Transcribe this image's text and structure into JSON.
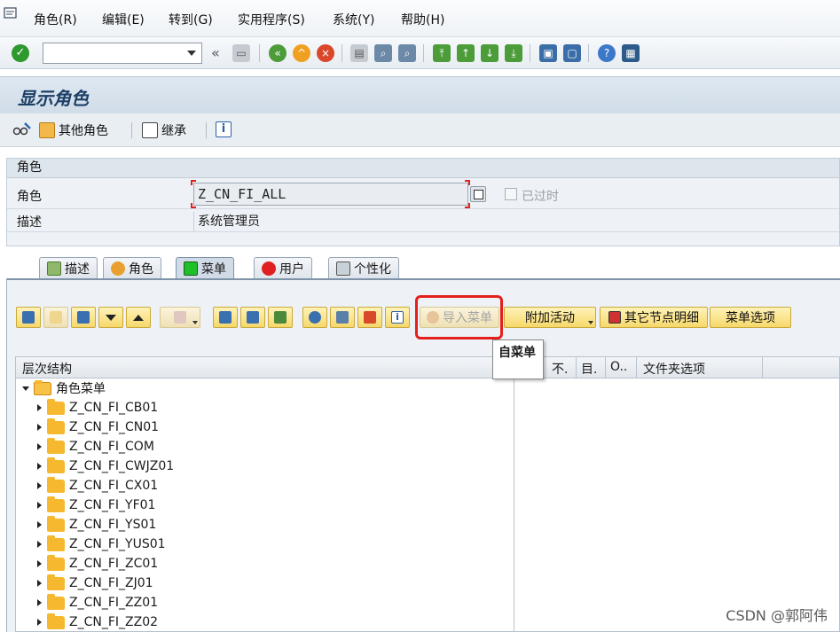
{
  "menubar": {
    "items": [
      "角色(R)",
      "编辑(E)",
      "转到(G)",
      "实用程序(S)",
      "系统(Y)",
      "帮助(H)"
    ]
  },
  "stdbar": {
    "command_value": "",
    "icons": [
      "enter-icon",
      "save-icon",
      "back-icon",
      "exit-icon",
      "cancel-icon",
      "print-icon",
      "find-icon",
      "find-next-icon",
      "first-page-icon",
      "prev-page-icon",
      "next-page-icon",
      "last-page-icon",
      "new-session-icon",
      "shortcut-icon",
      "help-icon",
      "layout-menu-icon"
    ]
  },
  "title": "显示角色",
  "apptoolbar": {
    "other_roles": "其他角色",
    "inherit": "继承"
  },
  "role_group": {
    "title": "角色",
    "role_label": "角色",
    "role_value": "Z_CN_FI_ALL",
    "obsolete_label": "已过时",
    "desc_label": "描述",
    "desc_value": "系统管理员"
  },
  "tabs": [
    {
      "label": "描述",
      "icon": "description-icon"
    },
    {
      "label": "角色",
      "icon": "role-icon"
    },
    {
      "label": "菜单",
      "icon": "menu-icon",
      "active": true
    },
    {
      "label": "用户",
      "icon": "user-icon"
    },
    {
      "label": "个性化",
      "icon": "personalization-icon"
    }
  ],
  "menu_toolbar": {
    "import_menu": "导入菜单",
    "additional_activities": "附加活动",
    "other_node_details": "其它节点明细",
    "menu_options": "菜单选项",
    "tooltip": "自菜单"
  },
  "tree": {
    "headers": {
      "hierarchy": "层次结构",
      "col_n": "不.",
      "col_m": "目.",
      "col_o": "O..",
      "col_folder": "文件夹选项"
    },
    "root": "角色菜单",
    "nodes": [
      "Z_CN_FI_CB01",
      "Z_CN_FI_CN01",
      "Z_CN_FI_COM",
      "Z_CN_FI_CWJZ01",
      "Z_CN_FI_CX01",
      "Z_CN_FI_YF01",
      "Z_CN_FI_YS01",
      "Z_CN_FI_YUS01",
      "Z_CN_FI_ZC01",
      "Z_CN_FI_ZJ01",
      "Z_CN_FI_ZZ01",
      "Z_CN_FI_ZZ02"
    ]
  },
  "watermark": "CSDN @郭阿伟",
  "colors": {
    "highlight": "#e4201c",
    "folder": "#f5b82e",
    "title": "#1c3f66"
  }
}
